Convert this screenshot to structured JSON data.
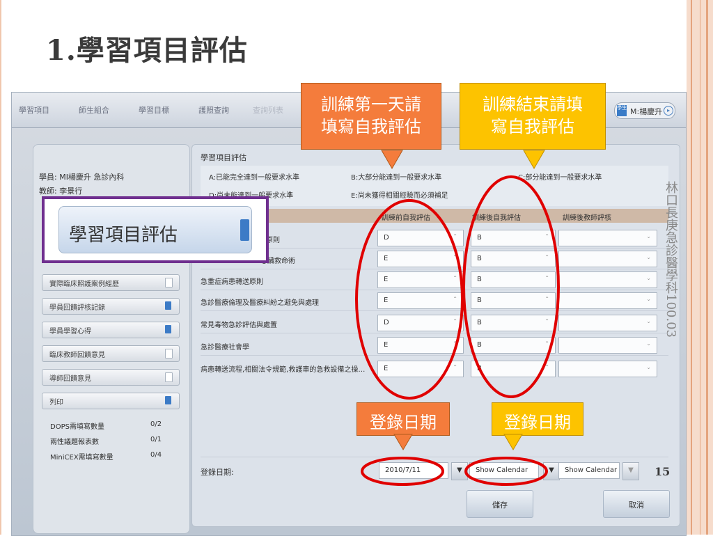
{
  "slide": {
    "title": "1.學習項目評估",
    "side_note": "林口長庚急診醫學科100.03",
    "page_number": "15"
  },
  "app": {
    "nav": [
      "學習項目",
      "師生組合",
      "學習目標",
      "護照查詢",
      "查詢列表"
    ],
    "user_tag": "學生",
    "user_name": "M:楊慶升",
    "left_panel": {
      "student": "學員:  MI楊慶升    急診內科",
      "teacher": "教師:  李景行",
      "menu": [
        "實際臨床照護案例經歷",
        "學員回饋評核記錄",
        "學員學習心得",
        "臨床教師回饋意見",
        "導師回饋意見",
        "列印"
      ],
      "stats": [
        {
          "label": "DOPS需填寫數量",
          "value": "0/2"
        },
        {
          "label": "兩性議題報表數",
          "value": "0/1"
        },
        {
          "label": "MiniCEX需填寫數量",
          "value": "0/4"
        }
      ]
    },
    "popup_label": "學習項目評估",
    "main": {
      "title": "學習項目評估",
      "legend": [
        "A:已能完全達到一般要求水準",
        "B:大部分能達到一般要求水準",
        "C:部分能達到一般要求水準",
        "D:尚未能達到一般要求水準",
        "E:尚未獲得相關經驗而必須補足"
      ],
      "columns": [
        "訓練前自我評估",
        "訓練後自我評估",
        "訓練後教師評核"
      ],
      "rows": [
        {
          "label": "處置原則",
          "pre": "D",
          "post": "B"
        },
        {
          "label": "心臟救命術",
          "pre": "E",
          "post": "B"
        },
        {
          "label": "急重症病患轉送原則",
          "pre": "E",
          "post": "B"
        },
        {
          "label": "急診醫療倫理及醫療糾紛之避免與處理",
          "pre": "E",
          "post": "B"
        },
        {
          "label": "常見毒物急診評估與處置",
          "pre": "D",
          "post": "B"
        },
        {
          "label": "急診醫療社會學",
          "pre": "E",
          "post": "B"
        },
        {
          "label": "病患轉送流程,相關法令規範,救護車的急救設備之操…",
          "pre": "E",
          "post": "B"
        }
      ],
      "date_label": "登錄日期:",
      "date_value": "2010/7/11",
      "show_calendar": "Show Calendar",
      "save": "儲存",
      "cancel": "取消"
    }
  },
  "callouts": {
    "first_day": "訓練第一天請填寫自我評估",
    "last_day": "訓練結束請填寫自我評估",
    "login_date_1": "登錄日期",
    "login_date_2": "登錄日期"
  },
  "colors": {
    "orange": "#f47c3c",
    "yellow": "#fdc300",
    "red": "#e00000",
    "purple": "#6f2f8f"
  }
}
